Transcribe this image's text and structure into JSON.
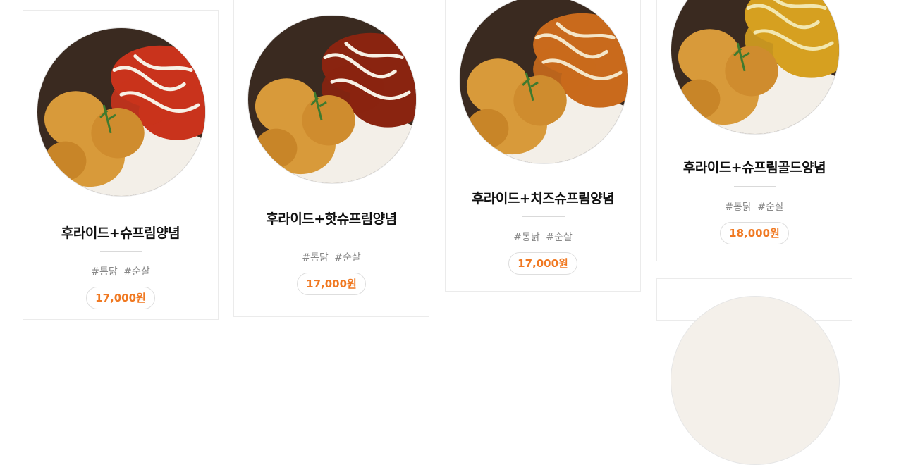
{
  "menu": {
    "items": [
      {
        "name": "후라이드+슈프림양념",
        "tags": [
          "#통닭",
          "#순살"
        ],
        "price": "17,000원",
        "sauce": "#c9331c",
        "drizzle": "#f7f1e6"
      },
      {
        "name": "후라이드+핫슈프림양념",
        "tags": [
          "#통닭",
          "#순살"
        ],
        "price": "17,000원",
        "sauce": "#8a2410",
        "drizzle": "#f7f1e6"
      },
      {
        "name": "후라이드+치즈슈프림양념",
        "tags": [
          "#통닭",
          "#순살"
        ],
        "price": "17,000원",
        "sauce": "#c96a1c",
        "drizzle": "#f4e6c9"
      },
      {
        "name": "후라이드+슈프림골드양념",
        "tags": [
          "#통닭",
          "#순살"
        ],
        "price": "18,000원",
        "sauce": "#d6a020",
        "drizzle": "#f2e7b0"
      }
    ]
  },
  "colors": {
    "price_text": "#f07922",
    "fried_chicken": "#d89a3a",
    "card_border": "#ebebeb"
  }
}
